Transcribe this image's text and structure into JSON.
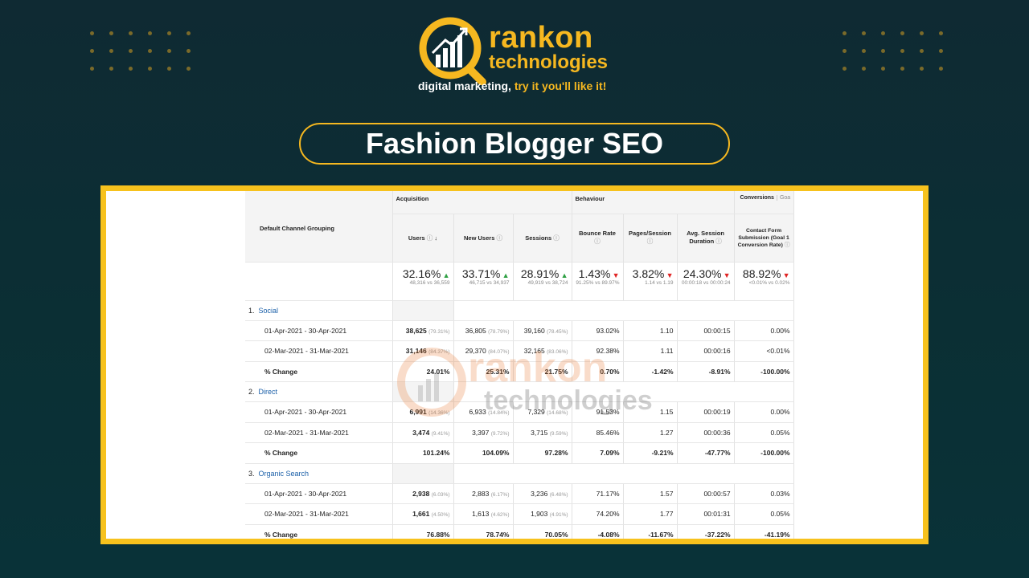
{
  "brand": {
    "name_line1": "rankon",
    "name_line2": "technologies",
    "tagline_part1": "digital marketing, ",
    "tagline_part2": "try it you'll like it!",
    "accent_color": "#f6b820"
  },
  "title": "Fashion Blogger SEO",
  "report": {
    "dimension_header": "Default Channel Grouping",
    "groups": {
      "acquisition": "Acquisition",
      "behaviour": "Behaviour",
      "conversions": "Conversions",
      "goal_tab": "Goa"
    },
    "columns": {
      "users": "Users",
      "new_users": "New Users",
      "sessions": "Sessions",
      "bounce_rate": "Bounce Rate",
      "pages_session": "Pages/Session",
      "avg_session": "Avg. Session Duration",
      "conversion": "Contact Form Submission (Goal 1 Conversion Rate)"
    },
    "summary": {
      "users": {
        "pct": "32.16%",
        "dir": "up",
        "sub": "48,316 vs 36,559"
      },
      "new_users": {
        "pct": "33.71%",
        "dir": "up",
        "sub": "46,715 vs 34,937"
      },
      "sessions": {
        "pct": "28.91%",
        "dir": "up",
        "sub": "49,919 vs 38,724"
      },
      "bounce_rate": {
        "pct": "1.43%",
        "dir": "down",
        "sub": "91.25% vs 89.97%"
      },
      "pages_session": {
        "pct": "3.82%",
        "dir": "down",
        "sub": "1.14 vs 1.19"
      },
      "avg_session": {
        "pct": "24.30%",
        "dir": "down",
        "sub": "00:00:18 vs 00:00:24"
      },
      "conversion": {
        "pct": "88.92%",
        "dir": "down",
        "sub": "<0.01% vs 0.02%"
      }
    },
    "channels": [
      {
        "index": "1.",
        "name": "Social",
        "rows": [
          {
            "label": "01-Apr-2021 - 30-Apr-2021",
            "users": "38,625",
            "users_p": "(79.31%)",
            "new_users": "36,805",
            "new_users_p": "(78.79%)",
            "sessions": "39,160",
            "sessions_p": "(78.45%)",
            "bounce": "93.02%",
            "pages": "1.10",
            "avg": "00:00:15",
            "conv": "0.00%"
          },
          {
            "label": "02-Mar-2021 - 31-Mar-2021",
            "users": "31,146",
            "users_p": "(84.37%)",
            "new_users": "29,370",
            "new_users_p": "(84.07%)",
            "sessions": "32,165",
            "sessions_p": "(83.06%)",
            "bounce": "92.38%",
            "pages": "1.11",
            "avg": "00:00:16",
            "conv": "<0.01%"
          },
          {
            "label": "% Change",
            "users": "24.01%",
            "users_p": "",
            "new_users": "25.31%",
            "new_users_p": "",
            "sessions": "21.75%",
            "sessions_p": "",
            "bounce": "0.70%",
            "pages": "-1.42%",
            "avg": "-8.91%",
            "conv": "-100.00%"
          }
        ]
      },
      {
        "index": "2.",
        "name": "Direct",
        "rows": [
          {
            "label": "01-Apr-2021 - 30-Apr-2021",
            "users": "6,991",
            "users_p": "(14.36%)",
            "new_users": "6,933",
            "new_users_p": "(14.84%)",
            "sessions": "7,329",
            "sessions_p": "(14.68%)",
            "bounce": "91.53%",
            "pages": "1.15",
            "avg": "00:00:19",
            "conv": "0.00%"
          },
          {
            "label": "02-Mar-2021 - 31-Mar-2021",
            "users": "3,474",
            "users_p": "(9.41%)",
            "new_users": "3,397",
            "new_users_p": "(9.72%)",
            "sessions": "3,715",
            "sessions_p": "(9.59%)",
            "bounce": "85.46%",
            "pages": "1.27",
            "avg": "00:00:36",
            "conv": "0.05%"
          },
          {
            "label": "% Change",
            "users": "101.24%",
            "users_p": "",
            "new_users": "104.09%",
            "new_users_p": "",
            "sessions": "97.28%",
            "sessions_p": "",
            "bounce": "7.09%",
            "pages": "-9.21%",
            "avg": "-47.77%",
            "conv": "-100.00%"
          }
        ]
      },
      {
        "index": "3.",
        "name": "Organic Search",
        "rows": [
          {
            "label": "01-Apr-2021 - 30-Apr-2021",
            "users": "2,938",
            "users_p": "(6.03%)",
            "new_users": "2,883",
            "new_users_p": "(6.17%)",
            "sessions": "3,236",
            "sessions_p": "(6.48%)",
            "bounce": "71.17%",
            "pages": "1.57",
            "avg": "00:00:57",
            "conv": "0.03%"
          },
          {
            "label": "02-Mar-2021 - 31-Mar-2021",
            "users": "1,661",
            "users_p": "(4.50%)",
            "new_users": "1,613",
            "new_users_p": "(4.62%)",
            "sessions": "1,903",
            "sessions_p": "(4.91%)",
            "bounce": "74.20%",
            "pages": "1.77",
            "avg": "00:01:31",
            "conv": "0.05%"
          },
          {
            "label": "% Change",
            "users": "76.88%",
            "users_p": "",
            "new_users": "78.74%",
            "new_users_p": "",
            "sessions": "70.05%",
            "sessions_p": "",
            "bounce": "-4.08%",
            "pages": "-11.67%",
            "avg": "-37.22%",
            "conv": "-41.19%"
          }
        ]
      }
    ]
  },
  "watermark": {
    "line1": "rankon",
    "line2": "technologies"
  }
}
